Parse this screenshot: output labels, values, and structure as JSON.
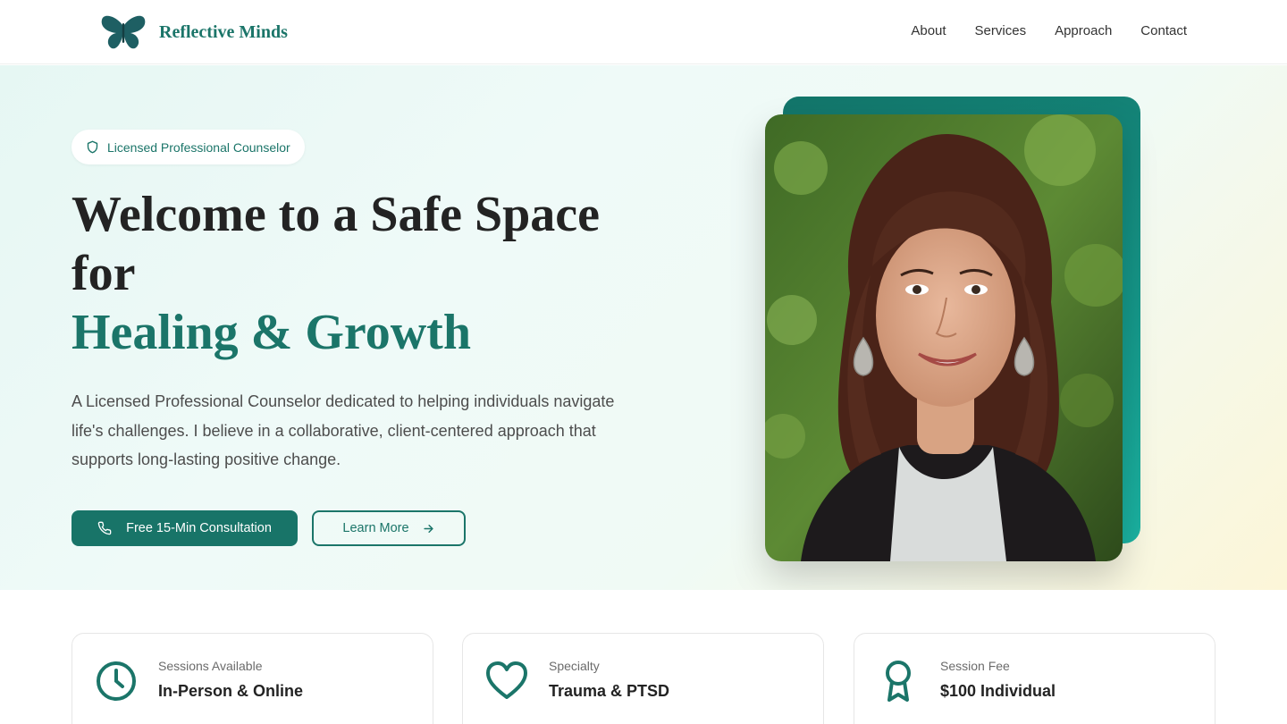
{
  "brand": {
    "name": "Reflective Minds",
    "color": "#1b7569"
  },
  "nav": {
    "items": [
      "About",
      "Services",
      "Approach",
      "Contact"
    ]
  },
  "hero": {
    "badge": "Licensed Professional Counselor",
    "headline_line1": "Welcome to a Safe Space for",
    "headline_accent": "Healing & Growth",
    "intro": "A Licensed Professional Counselor dedicated to helping individuals navigate life's challenges. I believe in a collaborative, client-centered approach that supports long-lasting positive change.",
    "primary_button": "Free 15-Min Consultation",
    "secondary_button": "Learn More"
  },
  "cards": [
    {
      "label": "Sessions Available",
      "value": "In-Person & Online",
      "icon": "clock-icon"
    },
    {
      "label": "Specialty",
      "value": "Trauma & PTSD",
      "icon": "heart-icon"
    },
    {
      "label": "Session Fee",
      "value": "$100 Individual",
      "icon": "award-ribbon-icon"
    }
  ],
  "colors": {
    "accent": "#1b7569",
    "button": "#187468",
    "text": "#232323"
  }
}
